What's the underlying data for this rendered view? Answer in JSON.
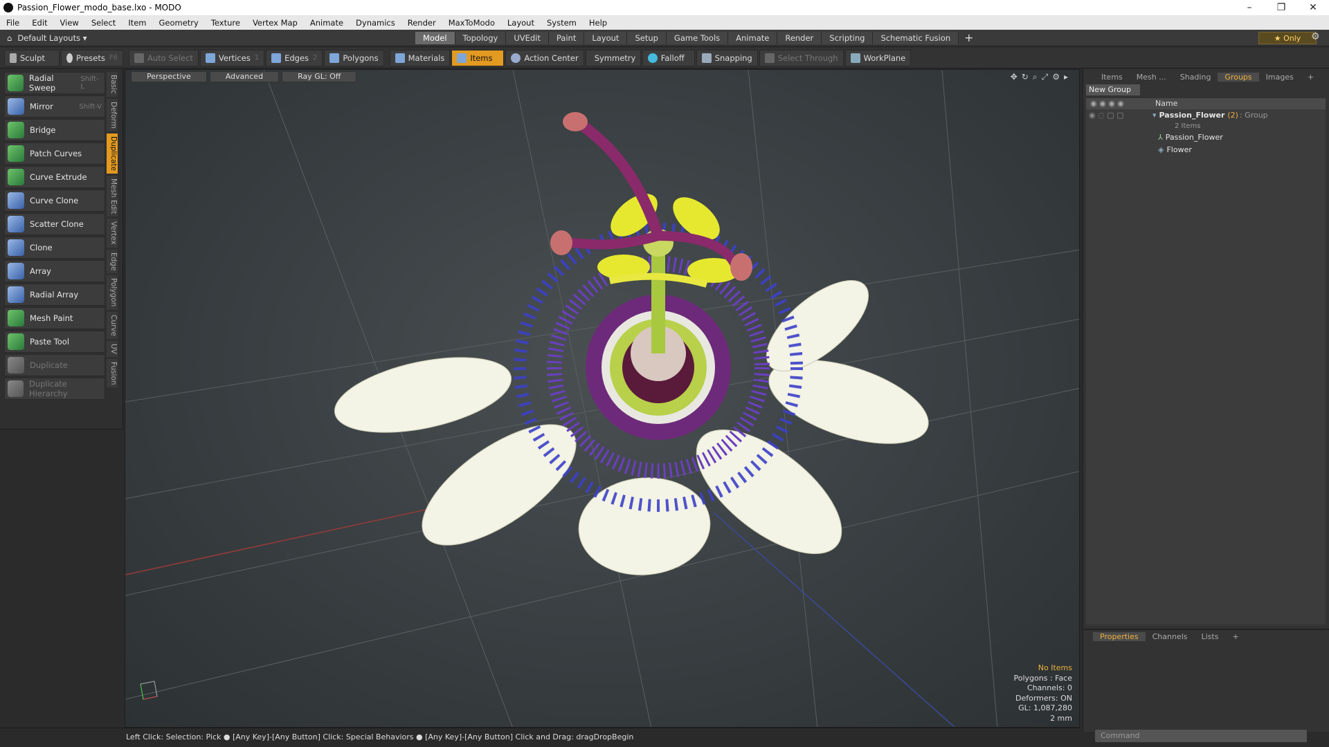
{
  "window": {
    "title": "Passion_Flower_modo_base.lxo - MODO",
    "minimize": "–",
    "restore": "❐",
    "close": "✕"
  },
  "menu": [
    "File",
    "Edit",
    "View",
    "Select",
    "Item",
    "Geometry",
    "Texture",
    "Vertex Map",
    "Animate",
    "Dynamics",
    "Render",
    "MaxToModo",
    "Layout",
    "System",
    "Help"
  ],
  "layoutbar": {
    "layout_label": "Default Layouts ▾",
    "tabs": [
      "Model",
      "Topology",
      "UVEdit",
      "Paint",
      "Layout",
      "Setup",
      "Game Tools",
      "Animate",
      "Render",
      "Scripting",
      "Schematic Fusion"
    ],
    "active_tab": "Model",
    "plus": "+",
    "only": "★ Only"
  },
  "toolbar": {
    "sculpt": "Sculpt",
    "presets": "Presets",
    "presets_key": "F6",
    "auto_select": "Auto Select",
    "vertices": "Vertices",
    "vertices_num": "1",
    "edges": "Edges",
    "edges_num": "2",
    "polygons": "Polygons",
    "materials": "Materials",
    "items": "Items",
    "action_center": "Action Center",
    "symmetry": "Symmetry",
    "falloff": "Falloff",
    "snapping": "Snapping",
    "select_through": "Select Through",
    "workplane": "WorkPlane"
  },
  "tools": [
    {
      "label": "Radial Sweep",
      "shortcut": "Shift-L"
    },
    {
      "label": "Mirror",
      "shortcut": "Shift-V"
    },
    {
      "label": "Bridge",
      "shortcut": ""
    },
    {
      "label": "Patch Curves",
      "shortcut": ""
    },
    {
      "label": "Curve Extrude",
      "shortcut": ""
    },
    {
      "label": "Curve Clone",
      "shortcut": ""
    },
    {
      "label": "Scatter Clone",
      "shortcut": ""
    },
    {
      "label": "Clone",
      "shortcut": ""
    },
    {
      "label": "Array",
      "shortcut": ""
    },
    {
      "label": "Radial Array",
      "shortcut": ""
    },
    {
      "label": "Mesh Paint",
      "shortcut": ""
    },
    {
      "label": "Paste Tool",
      "shortcut": ""
    },
    {
      "label": "Duplicate",
      "shortcut": ""
    },
    {
      "label": "Duplicate Hierarchy",
      "shortcut": ""
    }
  ],
  "vtabs": [
    "Basic",
    "Deform",
    "Duplicate",
    "Mesh Edit",
    "Vertex",
    "Edge",
    "Polygon",
    "Curve",
    "UV",
    "Fusion"
  ],
  "viewport": {
    "view": "Perspective",
    "shading": "Advanced",
    "raygl": "Ray GL: Off"
  },
  "info": {
    "no_items": "No Items",
    "polygons": "Polygons : Face",
    "channels": "Channels: 0",
    "deformers": "Deformers: ON",
    "gl": "GL: 1,087,280",
    "scale": "2 mm"
  },
  "right": {
    "tabs": [
      "Items",
      "Mesh ...",
      "Shading",
      "Groups",
      "Images"
    ],
    "active": "Groups",
    "new_group": "New Group",
    "name_col": "Name",
    "group_name": "Passion_Flower",
    "group_count": "(2)",
    "group_type": ": Group",
    "group_sub": "2 Items",
    "children": [
      "Passion_Flower",
      "Flower"
    ]
  },
  "props": {
    "tabs": [
      "Properties",
      "Channels",
      "Lists"
    ],
    "command_placeholder": "Command"
  },
  "status": "Left Click: Selection: Pick ● [Any Key]-[Any Button] Click: Special Behaviors ● [Any Key]-[Any Button] Click and Drag: dragDropBegin"
}
